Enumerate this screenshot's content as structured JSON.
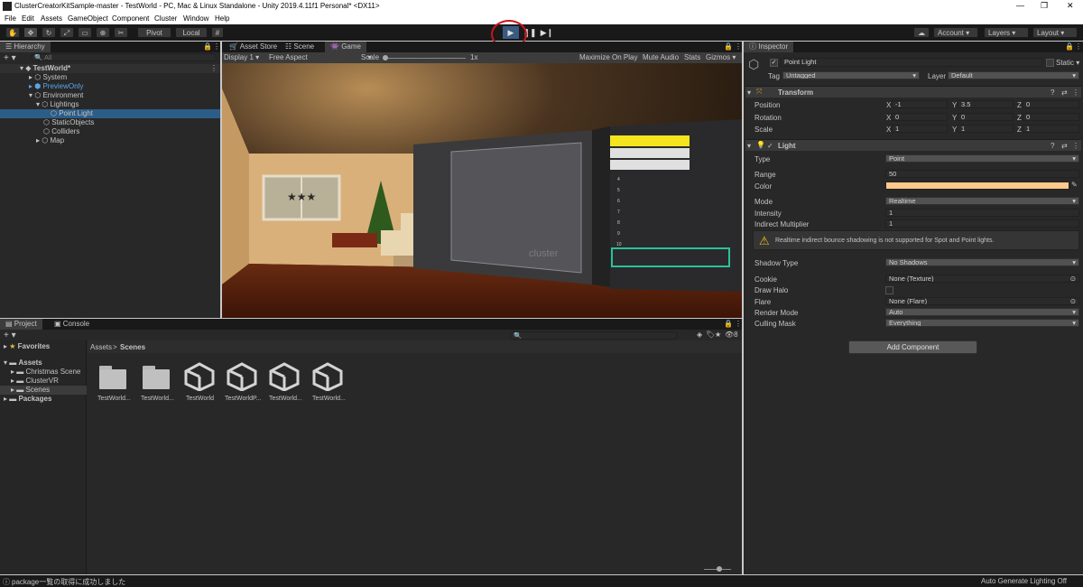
{
  "window": {
    "title": "ClusterCreatorKitSample-master - TestWorld - PC, Mac & Linux Standalone - Unity 2019.4.11f1 Personal* <DX11>",
    "controls": [
      "—",
      "❐",
      "✕"
    ]
  },
  "menu": [
    "File",
    "Edit",
    "Assets",
    "GameObject",
    "Component",
    "Cluster",
    "Window",
    "Help"
  ],
  "toolbar": {
    "pivot_label": "Pivot",
    "local_label": "Local",
    "account_label": "Account",
    "layers_label": "Layers",
    "layout_label": "Layout"
  },
  "hierarchy": {
    "tab": "Hierarchy",
    "search_placeholder": "All",
    "scene_name": "TestWorld*",
    "items": [
      "System",
      "PreviewOnly",
      "Environment",
      "Lightings",
      "Point Light",
      "StaticObjects",
      "Colliders",
      "Map"
    ]
  },
  "center_tabs": [
    "Asset Store",
    "Scene",
    "Game"
  ],
  "game_bar": {
    "display": "Display 1",
    "aspect": "Free Aspect",
    "scale_label": "Scale",
    "scale_value": "1x",
    "maximize": "Maximize On Play",
    "mute": "Mute Audio",
    "stats": "Stats",
    "gizmos": "Gizmos"
  },
  "game_view": {
    "screen_logo": "cluster",
    "leaderboard_ranks": [
      "4",
      "5",
      "6",
      "7",
      "8",
      "9",
      "10"
    ]
  },
  "project": {
    "tabs": [
      "Project",
      "Console"
    ],
    "favorites": "Favorites",
    "assets": "Assets",
    "asset_children": [
      "Christmas Scene",
      "ClusterVR",
      "Scenes"
    ],
    "packages": "Packages",
    "breadcrumb": [
      "Assets",
      "Scenes"
    ],
    "layer_count": "8",
    "files": [
      {
        "name": "TestWorld...",
        "kind": "folder"
      },
      {
        "name": "TestWorld...",
        "kind": "folder"
      },
      {
        "name": "TestWorld",
        "kind": "unity"
      },
      {
        "name": "TestWorldP...",
        "kind": "unity"
      },
      {
        "name": "TestWorld...",
        "kind": "unity"
      },
      {
        "name": "TestWorld...",
        "kind": "unity"
      }
    ]
  },
  "inspector": {
    "tab": "Inspector",
    "object_name": "Point Light",
    "static_label": "Static",
    "tag_label": "Tag",
    "tag_value": "Untagged",
    "layer_label": "Layer",
    "layer_value": "Default",
    "transform": {
      "title": "Transform",
      "position": {
        "label": "Position",
        "x": "-1",
        "y": "3.5",
        "z": "0"
      },
      "rotation": {
        "label": "Rotation",
        "x": "0",
        "y": "0",
        "z": "0"
      },
      "scale": {
        "label": "Scale",
        "x": "1",
        "y": "1",
        "z": "1"
      }
    },
    "light": {
      "title": "Light",
      "type_label": "Type",
      "type_value": "Point",
      "range_label": "Range",
      "range_value": "50",
      "color_label": "Color",
      "color_value": "#ffc98c",
      "mode_label": "Mode",
      "mode_value": "Realtime",
      "intensity_label": "Intensity",
      "intensity_value": "1",
      "indirect_label": "Indirect Multiplier",
      "indirect_value": "1",
      "warning": "Realtime indirect bounce shadowing is not supported for Spot and Point lights.",
      "shadow_label": "Shadow Type",
      "shadow_value": "No Shadows",
      "cookie_label": "Cookie",
      "cookie_value": "None (Texture)",
      "halo_label": "Draw Halo",
      "flare_label": "Flare",
      "flare_value": "None (Flare)",
      "render_label": "Render Mode",
      "render_value": "Auto",
      "culling_label": "Culling Mask",
      "culling_value": "Everything"
    },
    "add_component": "Add Component"
  },
  "status": {
    "message": "package一覧の取得に成功しました",
    "right": "Auto Generate Lighting Off"
  }
}
